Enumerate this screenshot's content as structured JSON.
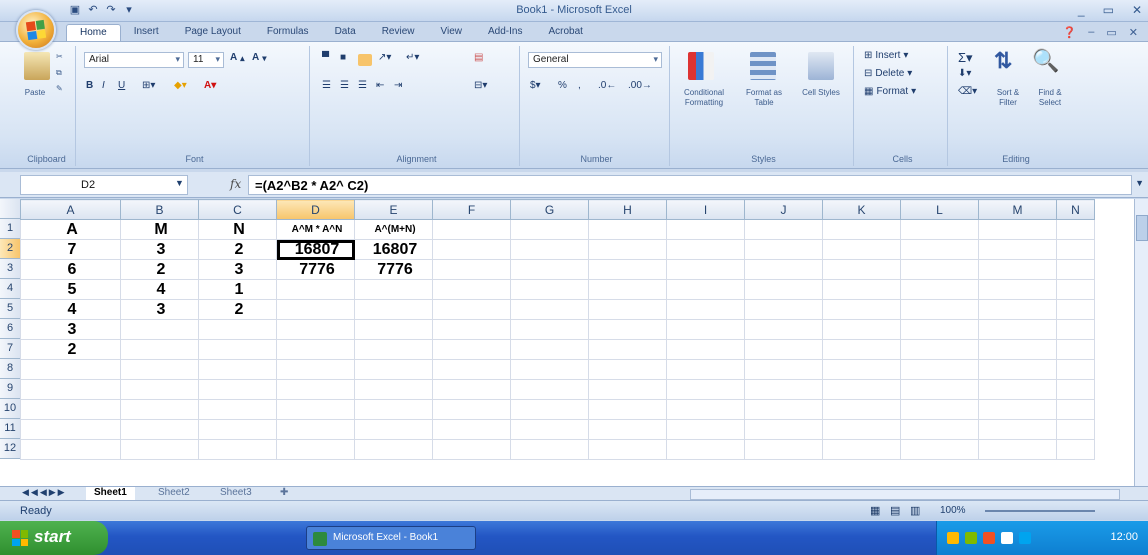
{
  "window": {
    "title": "Book1 - Microsoft Excel",
    "controls": [
      "_",
      "▭",
      "✕"
    ]
  },
  "ribbon_tabs": [
    "Home",
    "Insert",
    "Page Layout",
    "Formulas",
    "Data",
    "Review",
    "View",
    "Add-Ins",
    "Acrobat"
  ],
  "ribbon": {
    "clipboard": {
      "paste": "Paste",
      "label": "Clipboard"
    },
    "font": {
      "name": "Arial",
      "size": "11",
      "label": "Font"
    },
    "alignment": {
      "label": "Alignment"
    },
    "number": {
      "format": "General",
      "label": "Number"
    },
    "styles": {
      "conditional": "Conditional Formatting",
      "format_table": "Format as Table",
      "cell_styles": "Cell Styles",
      "label": "Styles"
    },
    "cells": {
      "insert": "Insert",
      "delete": "Delete",
      "format": "Format",
      "label": "Cells"
    },
    "editing": {
      "sort": "Sort & Filter",
      "find": "Find & Select",
      "label": "Editing"
    }
  },
  "formula_bar": {
    "name_box": "D2",
    "fx": "fx",
    "formula": "=(A2^B2 * A2^ C2)"
  },
  "columns": [
    "A",
    "B",
    "C",
    "D",
    "E",
    "F",
    "G",
    "H",
    "I",
    "J",
    "K",
    "L",
    "M",
    "N"
  ],
  "rows": [
    "1",
    "2",
    "3",
    "4",
    "5",
    "6",
    "7",
    "8",
    "9",
    "10",
    "11",
    "12"
  ],
  "cells": {
    "r1": [
      "A",
      "M",
      "N",
      "A^M * A^N",
      "A^(M+N)"
    ],
    "r2": [
      "7",
      "3",
      "2",
      "16807",
      "16807"
    ],
    "r3": [
      "6",
      "2",
      "3",
      "7776",
      "7776"
    ],
    "r4": [
      "5",
      "4",
      "1",
      "",
      ""
    ],
    "r5": [
      "4",
      "3",
      "2",
      "",
      ""
    ],
    "r6": [
      "3",
      "",
      "",
      "",
      ""
    ],
    "r7": [
      "2",
      "",
      "",
      "",
      ""
    ]
  },
  "active_cell": "D2",
  "sheets": [
    "Sheet1",
    "Sheet2",
    "Sheet3"
  ],
  "active_sheet": "Sheet1",
  "status": {
    "ready": "Ready",
    "zoom": "100%"
  },
  "taskbar": {
    "start": "start",
    "task_item": "Microsoft Excel - Book1",
    "clock": "12:00"
  },
  "colors": {
    "accent": "#f7c46b",
    "ribbon": "#d7e4f4",
    "taskbar": "#2356c4",
    "start": "#2f8f2f"
  }
}
